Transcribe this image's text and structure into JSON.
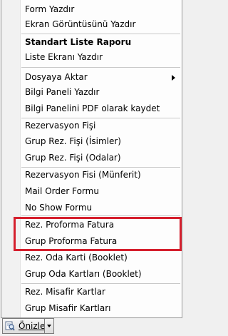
{
  "menu": {
    "items": [
      {
        "label": "Form Yazdır"
      },
      {
        "label": "Ekran Görüntüsünü Yazdır"
      },
      {
        "label": "Standart Liste Raporu"
      },
      {
        "label": "Liste Ekranı Yazdır"
      },
      {
        "label": "Dosyaya Aktar"
      },
      {
        "label": "Bilgi Paneli Yazdır"
      },
      {
        "label": "Bilgi Panelini PDF olarak kaydet"
      },
      {
        "label": "Rezervasyon Fişi"
      },
      {
        "label": "Grup Rez. Fişi (İsimler)"
      },
      {
        "label": "Grup Rez. Fişi (Odalar)"
      },
      {
        "label": "Rezervasyon Fisi (Münferit)"
      },
      {
        "label": "Mail Order Formu"
      },
      {
        "label": "No Show Formu"
      },
      {
        "label": "Rez. Proforma Fatura"
      },
      {
        "label": "Grup Proforma Fatura"
      },
      {
        "label": "Rez. Oda Karti (Booklet)"
      },
      {
        "label": "Grup Oda Kartları (Booklet)"
      },
      {
        "label": "Rez. Misafir Kartlar"
      },
      {
        "label": "Grup Misafir Kartları"
      }
    ]
  },
  "toolbar": {
    "preview_label": "Önizle",
    "preview_icon": "print-preview-icon",
    "dropdown_icon": "chevron-down-icon"
  },
  "colors": {
    "highlight_border": "#d51f2d",
    "menu_background": "#fdfdfd",
    "gutter_background": "#f1f1f1"
  }
}
